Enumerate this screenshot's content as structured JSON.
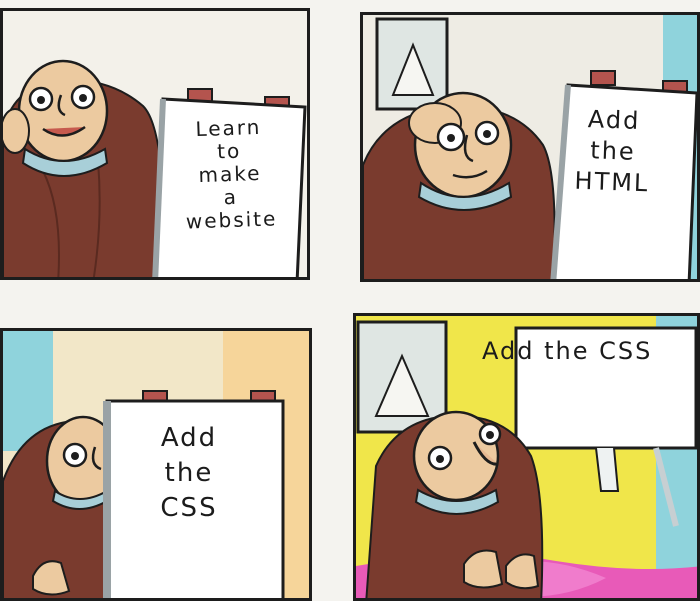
{
  "comic": {
    "panels": [
      {
        "sign_text": "Learn\nto\nmake\na\nwebsite"
      },
      {
        "sign_text": "Add\nthe\nHTML"
      },
      {
        "sign_text": "Add\nthe\nCSS"
      },
      {
        "sign_text": "Add the CSS"
      }
    ]
  },
  "colors": {
    "coat": "#7a3b2e",
    "skin": "#eccaa0",
    "scarf": "#a8cfd8",
    "ink": "#1d1d1d",
    "floor_pink": "#e85ab8",
    "wall_yellow": "#f0e64a",
    "wall_cream": "#f2e7c8",
    "wall_cyan": "#8fd3dc"
  }
}
